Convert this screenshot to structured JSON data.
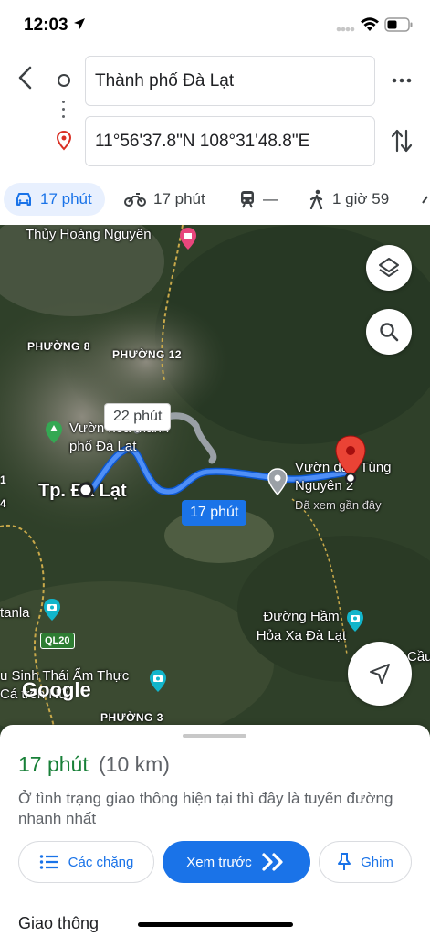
{
  "status_bar": {
    "time": "12:03"
  },
  "header": {
    "origin": "Thành phố Đà Lạt",
    "destination": "11°56'37.8\"N 108°31'48.8\"E"
  },
  "modes": [
    {
      "icon": "car-icon",
      "label": "17 phút",
      "active": true
    },
    {
      "icon": "motorbike-icon",
      "label": "17 phút"
    },
    {
      "icon": "transit-icon",
      "label": "—"
    },
    {
      "icon": "walk-icon",
      "label": "1 giờ 59"
    }
  ],
  "map": {
    "labels": {
      "thuy_hoang": "Thủy Hoàng Nguyên",
      "phuong8": "PHƯỜNG 8",
      "phuong12": "PHƯỜNG 12",
      "vuon_hoa": "Vườn hoa thành phố Đà Lạt",
      "tp_dalat": "Tp. Đà Lạt",
      "vuon_dau": "Vườn dâu Tùng Nguyên 2",
      "da_xem": "Đã xem gần đây",
      "duong_ham": "Đường Hầm Hỏa Xa Đà Lạt",
      "sinh_thai": "u Sinh Thái Ẩm Thực Cá   trên Núi",
      "phuong3": "PHƯỜNG 3",
      "tanla": "tanla",
      "cau": "Cầu",
      "edge1": "1",
      "edge4": "4",
      "ql20": "QL20",
      "google": "Google"
    },
    "route_tags": {
      "alt": "22 phút",
      "main": "17 phút"
    }
  },
  "sheet": {
    "duration": "17 phút",
    "distance": "(10 km)",
    "note": "Ở tình trạng giao thông hiện tại thì đây là tuyến đường nhanh nhất",
    "buttons": {
      "steps": "Các chặng",
      "preview": "Xem trước",
      "pin": "Ghim"
    },
    "traffic": "Giao thông"
  }
}
